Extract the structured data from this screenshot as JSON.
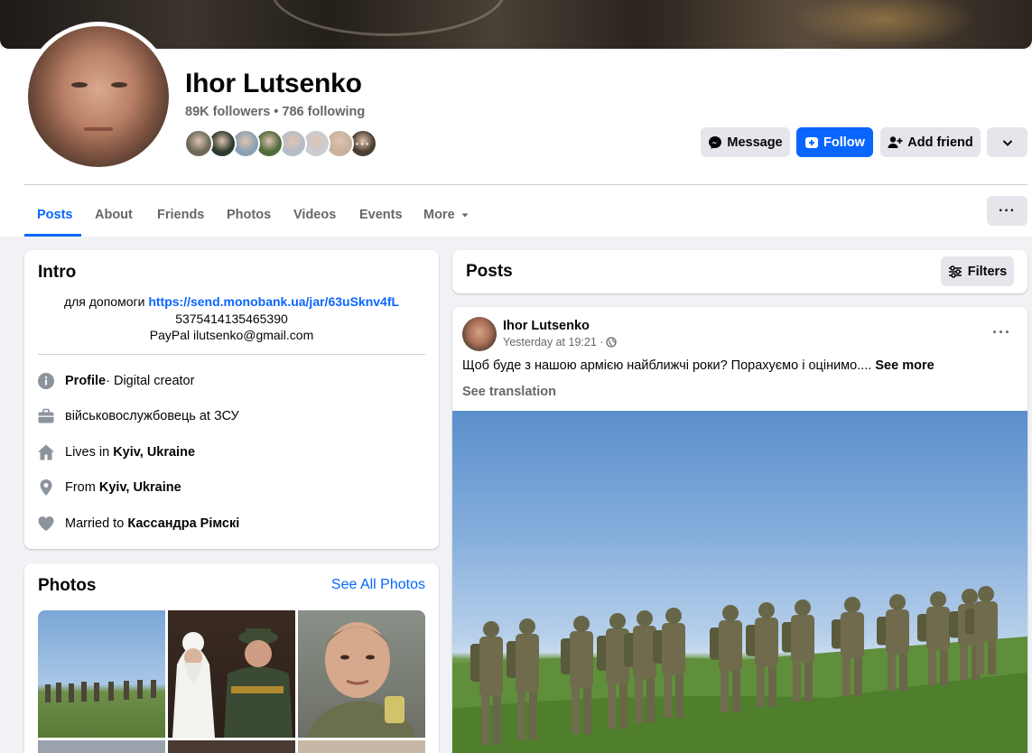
{
  "profile": {
    "name": "Ihor Lutsenko",
    "stats": "89K followers • 786 following",
    "friend_avatar_colors": [
      "#6d6a5a",
      "#2f3a2f",
      "#8aa0b3",
      "#4f6b3a",
      "#b7bcc9",
      "#c9ccd1",
      "#c8b29c",
      "#4a3e32"
    ],
    "friend_avatar_more": "···"
  },
  "actions": {
    "message_label": "Message",
    "follow_label": "Follow",
    "add_friend_label": "Add friend",
    "dropdown_icon": "chevron-down-icon"
  },
  "tabs": {
    "items": [
      "Posts",
      "About",
      "Friends",
      "Photos",
      "Videos",
      "Events",
      "More"
    ],
    "more_menu": "···"
  },
  "intro": {
    "title": "Intro",
    "bio_prefix": "для допомоги",
    "bio_link": "https://send.monobank.ua/jar/63uSknv4fL",
    "bio_line2": "5375414135465390",
    "bio_line3": "PayPal ilutsenko@gmail.com",
    "profile_label": "Profile",
    "profile_rest": " · Digital creator",
    "work": "військовослужбовець at ЗСУ",
    "lives_prefix": "Lives in ",
    "lives_place": "Kyiv, Ukraine",
    "from_prefix": "From ",
    "from_place": "Kyiv, Ukraine",
    "married_prefix": "Married to ",
    "married_name": "Кассандра Рімскі"
  },
  "photos": {
    "title": "Photos",
    "see_all": "See All Photos"
  },
  "posts": {
    "title": "Posts",
    "filters_label": "Filters"
  },
  "post": {
    "author": "Ihor Lutsenko",
    "time": "Yesterday at 19:21 ·",
    "menu": "···",
    "text": "Щоб буде з нашою армією найближчі роки? Порахуємо і оцінимо....",
    "see_more": "See more",
    "see_translation": "See translation"
  },
  "colors": {
    "accent": "#0866ff",
    "secondary_text": "#65676b",
    "button_gray": "#e4e6eb"
  }
}
